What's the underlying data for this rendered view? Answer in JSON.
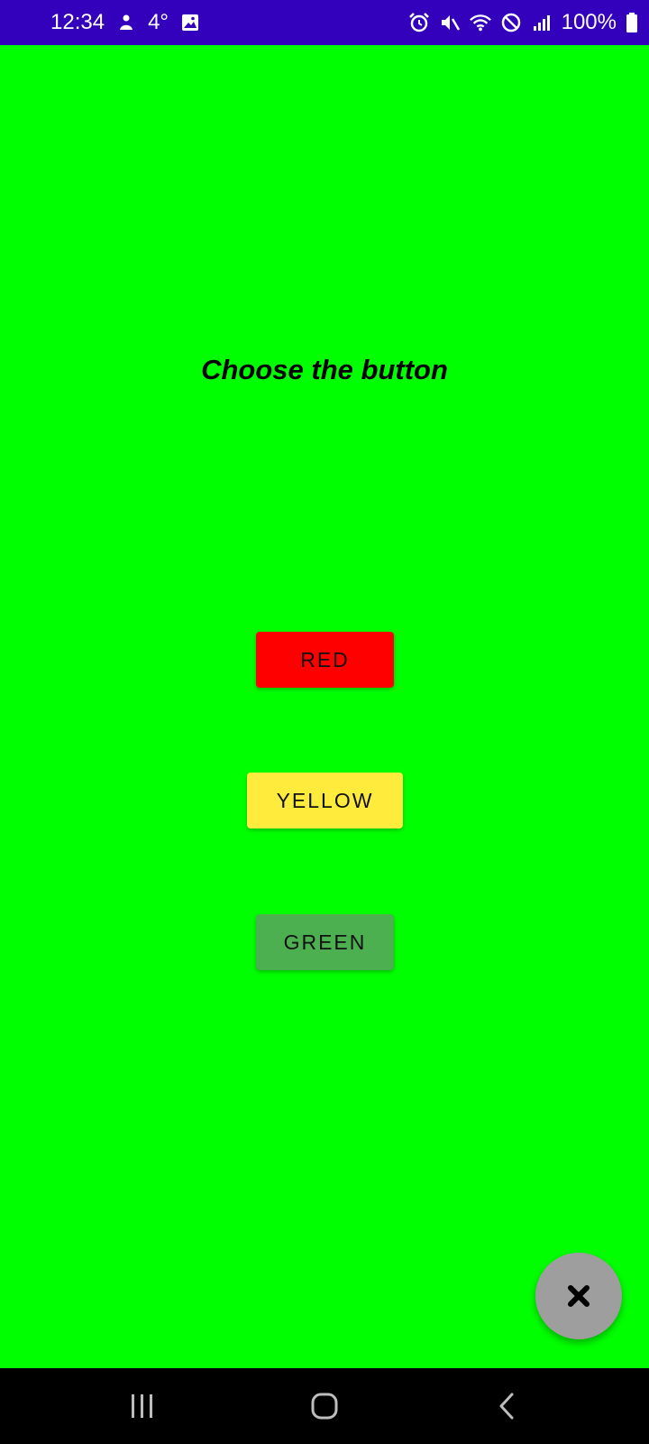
{
  "status_bar": {
    "time": "12:34",
    "temperature": "4°",
    "battery": "100%",
    "background_color": "#3300bb",
    "icons_left": [
      "notification-app-icon",
      "gallery-icon"
    ],
    "icons_right": [
      "alarm-icon",
      "mute-icon",
      "wifi-icon",
      "do-not-disturb-icon",
      "signal-icon",
      "battery-icon"
    ]
  },
  "screen": {
    "background_color": "#00ff00",
    "prompt": "Choose the button"
  },
  "buttons": {
    "red": {
      "label": "RED",
      "color": "#ff0000"
    },
    "yellow": {
      "label": "YELLOW",
      "color": "#ffeb3b"
    },
    "green": {
      "label": "GREEN",
      "color": "#4caf50"
    }
  },
  "fab": {
    "icon": "close-icon",
    "color": "#9e9e9e"
  },
  "nav_bar": {
    "icons": [
      "recents-icon",
      "home-icon",
      "back-icon"
    ]
  }
}
